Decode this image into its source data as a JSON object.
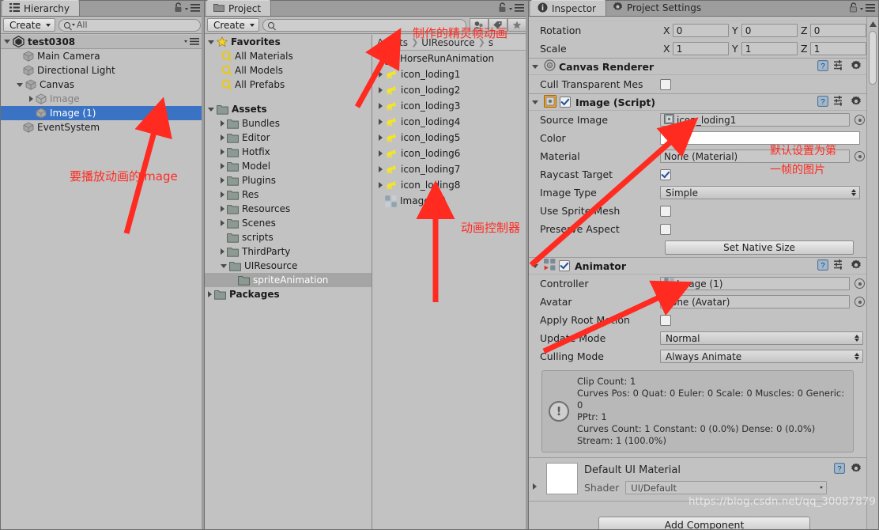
{
  "hierarchy": {
    "tab_label": "Hierarchy",
    "create_label": "Create",
    "search_placeholder": "All",
    "scene_name": "test0308",
    "items": [
      {
        "label": "Main Camera",
        "depth": 1,
        "arrow": "none",
        "selected": false,
        "dim": false
      },
      {
        "label": "Directional Light",
        "depth": 1,
        "arrow": "none",
        "selected": false,
        "dim": false
      },
      {
        "label": "Canvas",
        "depth": 1,
        "arrow": "open",
        "selected": false,
        "dim": false
      },
      {
        "label": "Image",
        "depth": 2,
        "arrow": "closed",
        "selected": false,
        "dim": true
      },
      {
        "label": "Image (1)",
        "depth": 2,
        "arrow": "none",
        "selected": true,
        "dim": false
      },
      {
        "label": "EventSystem",
        "depth": 1,
        "arrow": "none",
        "selected": false,
        "dim": false
      }
    ]
  },
  "project": {
    "tab_label": "Project",
    "create_label": "Create",
    "search_placeholder": "",
    "favorites_label": "Favorites",
    "favorites": [
      "All Materials",
      "All Models",
      "All Prefabs"
    ],
    "assets_label": "Assets",
    "folders": [
      {
        "label": "Bundles",
        "arrow": "closed",
        "depth": 1,
        "selected": false
      },
      {
        "label": "Editor",
        "arrow": "closed",
        "depth": 1,
        "selected": false
      },
      {
        "label": "Hotfix",
        "arrow": "closed",
        "depth": 1,
        "selected": false
      },
      {
        "label": "Model",
        "arrow": "closed",
        "depth": 1,
        "selected": false
      },
      {
        "label": "Plugins",
        "arrow": "closed",
        "depth": 1,
        "selected": false
      },
      {
        "label": "Res",
        "arrow": "closed",
        "depth": 1,
        "selected": false
      },
      {
        "label": "Resources",
        "arrow": "closed",
        "depth": 1,
        "selected": false
      },
      {
        "label": "Scenes",
        "arrow": "closed",
        "depth": 1,
        "selected": false
      },
      {
        "label": "scripts",
        "arrow": "none",
        "depth": 1,
        "selected": false
      },
      {
        "label": "ThirdParty",
        "arrow": "closed",
        "depth": 1,
        "selected": false
      },
      {
        "label": "UIResource",
        "arrow": "open",
        "depth": 1,
        "selected": false
      },
      {
        "label": "spriteAnimation",
        "arrow": "none",
        "depth": 2,
        "selected": true
      }
    ],
    "packages_label": "Packages",
    "breadcrumb": [
      "Assets",
      "UIResource",
      "s"
    ],
    "assets_list": [
      {
        "label": "HorseRunAnimation",
        "icon": "animation-clip-icon",
        "arrow": "none"
      },
      {
        "label": "icon_loding1",
        "icon": "horse-sprite-icon",
        "arrow": "closed"
      },
      {
        "label": "icon_loding2",
        "icon": "horse-sprite-icon",
        "arrow": "closed"
      },
      {
        "label": "icon_loding3",
        "icon": "horse-sprite-icon",
        "arrow": "closed"
      },
      {
        "label": "icon_loding4",
        "icon": "horse-sprite-icon",
        "arrow": "closed"
      },
      {
        "label": "icon_loding5",
        "icon": "horse-sprite-icon",
        "arrow": "closed"
      },
      {
        "label": "icon_loding6",
        "icon": "horse-sprite-icon",
        "arrow": "closed"
      },
      {
        "label": "icon_loding7",
        "icon": "horse-sprite-icon",
        "arrow": "closed"
      },
      {
        "label": "icon_loding8",
        "icon": "horse-sprite-icon",
        "arrow": "closed"
      },
      {
        "label": "Image (1)",
        "icon": "animator-controller-icon",
        "arrow": "none"
      }
    ]
  },
  "inspector": {
    "tab_label": "Inspector",
    "tab2_label": "Project Settings",
    "transform": {
      "rotation_label": "Rotation",
      "scale_label": "Scale",
      "axis_x": "X",
      "axis_y": "Y",
      "axis_z": "Z",
      "rotation": {
        "x": "0",
        "y": "0",
        "z": "0"
      },
      "scale": {
        "x": "1",
        "y": "1",
        "z": "1"
      }
    },
    "canvas_renderer": {
      "title": "Canvas Renderer",
      "cull_label": "Cull Transparent Mes",
      "cull_checked": false
    },
    "image_script": {
      "title": "Image (Script)",
      "enabled": true,
      "source_image_label": "Source Image",
      "source_image_value": "icon_loding1",
      "color_label": "Color",
      "color_value": "#FFFFFF",
      "material_label": "Material",
      "material_value": "None (Material)",
      "raycast_label": "Raycast Target",
      "raycast_checked": true,
      "image_type_label": "Image Type",
      "image_type_value": "Simple",
      "sprite_mesh_label": "Use Sprite Mesh",
      "sprite_mesh_checked": false,
      "preserve_aspect_label": "Preserve Aspect",
      "preserve_aspect_checked": false,
      "native_size_label": "Set Native Size"
    },
    "animator": {
      "title": "Animator",
      "enabled": true,
      "controller_label": "Controller",
      "controller_value": "Image (1)",
      "avatar_label": "Avatar",
      "avatar_value": "None (Avatar)",
      "root_motion_label": "Apply Root Motion",
      "root_motion_checked": false,
      "update_mode_label": "Update Mode",
      "update_mode_value": "Normal",
      "culling_mode_label": "Culling Mode",
      "culling_mode_value": "Always Animate",
      "info": [
        "Clip Count: 1",
        "Curves Pos: 0 Quat: 0 Euler: 0 Scale: 0 Muscles: 0 Generic: 0",
        "PPtr: 1",
        "Curves Count: 1 Constant: 0 (0.0%) Dense: 0 (0.0%)",
        "Stream: 1 (100.0%)"
      ]
    },
    "material": {
      "name": "Default UI Material",
      "shader_label": "Shader",
      "shader_value": "UI/Default"
    },
    "add_component_label": "Add Component"
  },
  "annotations": {
    "hierarchy_note": "要播放动画的image",
    "project_title_note": "制作的精灵帧动画",
    "controller_note": "动画控制器",
    "source_note_line1": "默认设置为第",
    "source_note_line2": "一帧的图片"
  },
  "watermark": "https://blog.csdn.net/qq_30087879",
  "colors": {
    "selection_blue": "#3a72c4",
    "annotation_red": "#ff2b21",
    "panel_gray": "#c2c2c2",
    "sprite_yellow": "#f5e524"
  }
}
